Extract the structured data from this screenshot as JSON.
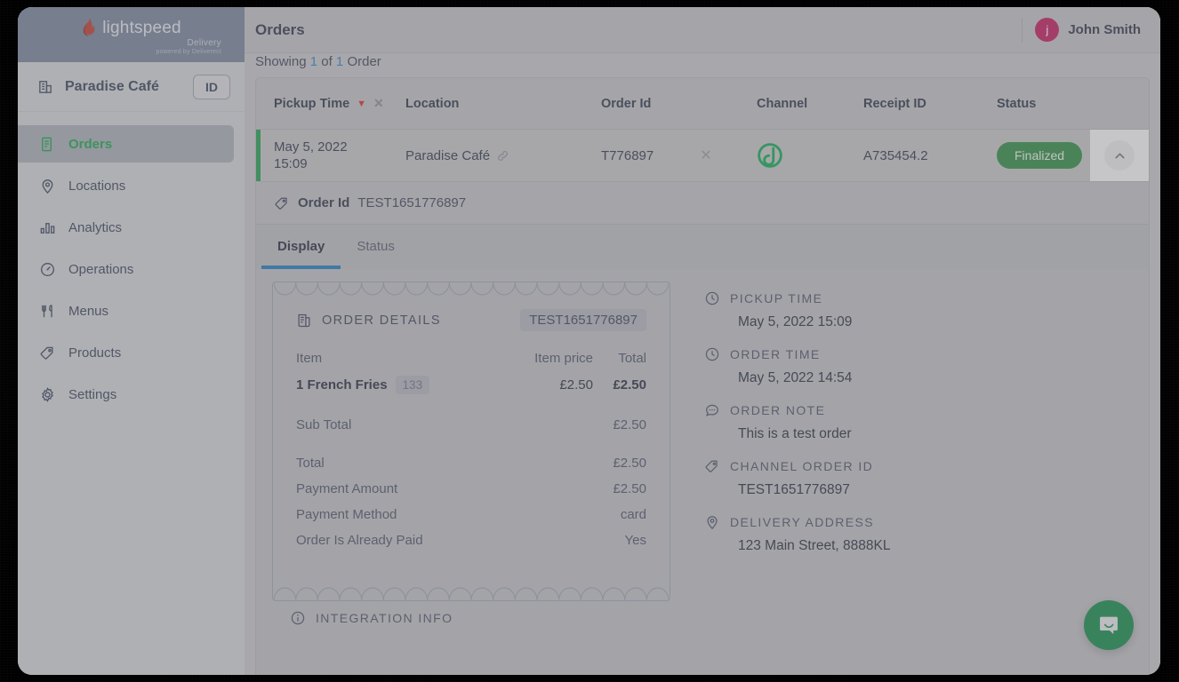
{
  "brand": {
    "word": "lightspeed",
    "product": "Delivery",
    "tagline": "powered by Deliverect"
  },
  "sidebar": {
    "store": {
      "name": "Paradise Café",
      "id_button": "ID",
      "icon": "building-icon"
    },
    "items": [
      {
        "label": "Orders",
        "icon": "clipboard-icon",
        "active": true
      },
      {
        "label": "Locations",
        "icon": "map-pin-icon",
        "active": false
      },
      {
        "label": "Analytics",
        "icon": "bar-chart-icon",
        "active": false
      },
      {
        "label": "Operations",
        "icon": "gauge-icon",
        "active": false
      },
      {
        "label": "Menus",
        "icon": "cutlery-icon",
        "active": false
      },
      {
        "label": "Products",
        "icon": "tag-icon",
        "active": false
      },
      {
        "label": "Settings",
        "icon": "gear-icon",
        "active": false
      }
    ]
  },
  "topbar": {
    "title": "Orders",
    "user_name": "John Smith",
    "avatar_initial": "j"
  },
  "list": {
    "showing_prefix": "Showing",
    "showing_count": "1",
    "showing_of": "of",
    "showing_total": "1",
    "showing_suffix": "Order"
  },
  "table": {
    "columns": [
      {
        "label": "Pickup Time"
      },
      {
        "label": "Location"
      },
      {
        "label": "Order Id"
      },
      {
        "label": "Channel"
      },
      {
        "label": "Receipt ID"
      },
      {
        "label": "Status"
      }
    ],
    "sort_indicator": "▼",
    "sort_clear": "✕",
    "row": {
      "pickup_date": "May 5, 2022",
      "pickup_clock": "15:09",
      "location": "Paradise Café",
      "location_icon": "link-icon",
      "order_id": "T776897",
      "order_id_clear": "✕",
      "channel_icon": "deliverect-icon",
      "receipt_id": "A735454.2",
      "status": "Finalized",
      "status_color": "#2e8b40",
      "collapse_icon": "chevron-up-icon"
    }
  },
  "detail": {
    "order_id_label": "Order Id",
    "order_id_value": "TEST1651776897",
    "order_id_icon": "tag-icon",
    "tabs": [
      {
        "label": "Display",
        "active": true
      },
      {
        "label": "Status",
        "active": false
      }
    ],
    "receipt": {
      "title": "ORDER DETAILS",
      "title_icon": "receipt-icon",
      "chip": "TEST1651776897",
      "col_item": "Item",
      "col_price": "Item price",
      "col_total": "Total",
      "lines": [
        {
          "name": "1 French Fries",
          "plu": "133",
          "price": "£2.50",
          "total": "£2.50"
        }
      ],
      "summary": [
        {
          "label": "Sub Total",
          "value": "£2.50"
        },
        {
          "label": "Total",
          "value": "£2.50"
        },
        {
          "label": "Payment Amount",
          "value": "£2.50"
        },
        {
          "label": "Payment Method",
          "value": "card"
        },
        {
          "label": "Order Is Already Paid",
          "value": "Yes"
        }
      ]
    },
    "info": [
      {
        "label": "PICKUP TIME",
        "value": "May 5, 2022 15:09",
        "icon": "clock-icon"
      },
      {
        "label": "ORDER TIME",
        "value": "May 5, 2022 14:54",
        "icon": "clock-icon"
      },
      {
        "label": "ORDER NOTE",
        "value": "This is a test order",
        "icon": "comment-icon"
      },
      {
        "label": "CHANNEL ORDER ID",
        "value": "TEST1651776897",
        "icon": "tag-icon"
      },
      {
        "label": "DELIVERY ADDRESS",
        "value": "123 Main Street, 8888KL",
        "icon": "map-pin-icon"
      }
    ],
    "integration_label": "INTEGRATION INFO",
    "integration_icon": "info-icon"
  },
  "intercom": {
    "icon": "chat-bubble-icon",
    "color": "#0f8a46"
  },
  "colors": {
    "accent_green": "#16a34a",
    "brand_header": "#77839a",
    "flame_red": "#c0392b",
    "tab_active": "#1d7bbf",
    "link_blue": "#2f80c8",
    "avatar_pink": "#c2185b"
  }
}
